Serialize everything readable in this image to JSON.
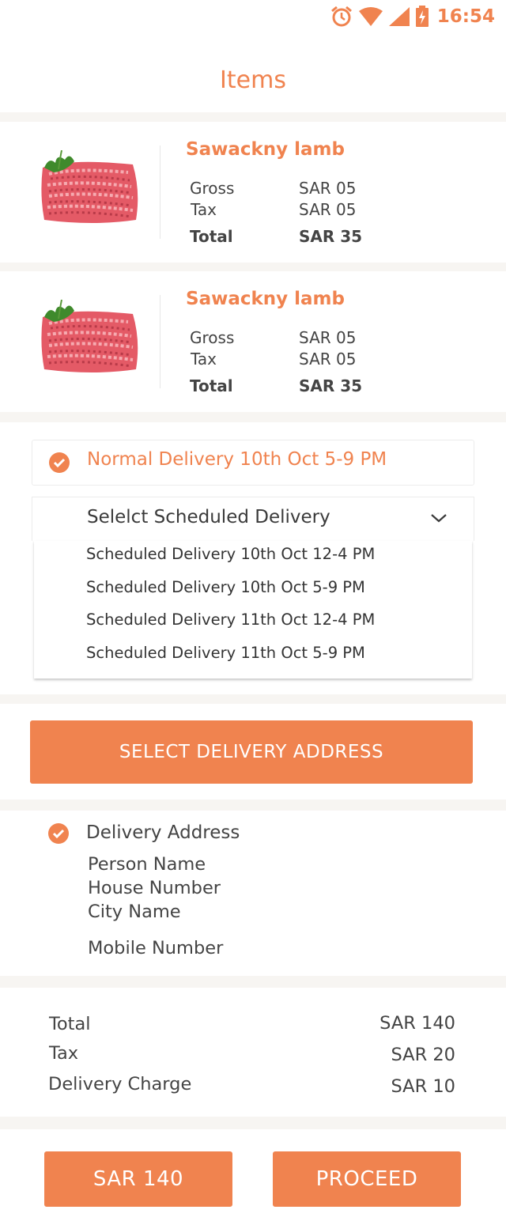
{
  "status_bar": {
    "time": "16:54",
    "icons": [
      "alarm-icon",
      "wifi-icon",
      "cell-signal-icon",
      "battery-charging-icon"
    ]
  },
  "page": {
    "title": "Items"
  },
  "items": [
    {
      "name": "Sawackny lamb",
      "image": "minced-meat-image",
      "gross_label": "Gross",
      "gross_value": "SAR 05",
      "tax_label": "Tax",
      "tax_value": "SAR 05",
      "total_label": "Total",
      "total_value": "SAR 35"
    },
    {
      "name": "Sawackny lamb",
      "image": "minced-meat-image",
      "gross_label": "Gross",
      "gross_value": "SAR 05",
      "tax_label": "Tax",
      "tax_value": "SAR 05",
      "total_label": "Total",
      "total_value": "SAR 35"
    }
  ],
  "delivery": {
    "normal_label": "Normal Delivery 10th Oct 5-9 PM",
    "normal_selected": true,
    "scheduled_title": "Selelct Scheduled Delivery",
    "scheduled_options": [
      "Scheduled Delivery 10th Oct 12-4 PM",
      "Scheduled Delivery 10th Oct 5-9 PM",
      "Scheduled Delivery 11th Oct 12-4 PM",
      "Scheduled Delivery 11th Oct 5-9 PM"
    ]
  },
  "address_button": {
    "label": "SELECT DELIVERY ADDRESS"
  },
  "address": {
    "title": "Delivery Address",
    "person": "Person Name",
    "house": "House Number",
    "city": "City Name",
    "mobile": "Mobile Number"
  },
  "totals": {
    "total_label": "Total",
    "total_value": "SAR 140",
    "tax_label": "Tax",
    "tax_value": "SAR 20",
    "delivery_label": "Delivery Charge",
    "delivery_value": "SAR 10"
  },
  "footer": {
    "amount_label": "SAR 140",
    "proceed_label": "PROCEED"
  },
  "colors": {
    "accent": "#f0834f",
    "separator": "#f7f5f2",
    "text": "#3a3a3a"
  }
}
